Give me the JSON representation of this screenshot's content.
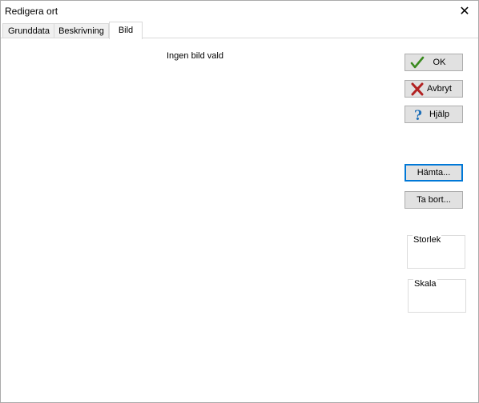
{
  "window": {
    "title": "Redigera ort",
    "close_symbol": "✕"
  },
  "tabs": [
    {
      "label": "Grunddata",
      "active": false
    },
    {
      "label": "Beskrivning",
      "active": false
    },
    {
      "label": "Bild",
      "active": true
    }
  ],
  "image_panel": {
    "status_text": "Ingen bild vald"
  },
  "buttons": {
    "ok": {
      "label": "OK",
      "icon": "checkmark-icon"
    },
    "cancel": {
      "label": "Avbryt",
      "icon": "red-x-icon"
    },
    "help": {
      "label": "Hjälp",
      "icon": "question-icon"
    },
    "fetch": {
      "label": "Hämta..."
    },
    "remove": {
      "label": "Ta bort..."
    }
  },
  "groups": {
    "size": {
      "label": "Storlek"
    },
    "scale": {
      "label": "Skala"
    }
  },
  "colors": {
    "focus_border": "#0078d7",
    "button_face": "#e1e1e1",
    "check_green": "#3a8a1f",
    "x_red": "#b22222",
    "help_blue": "#1e6fb8"
  }
}
